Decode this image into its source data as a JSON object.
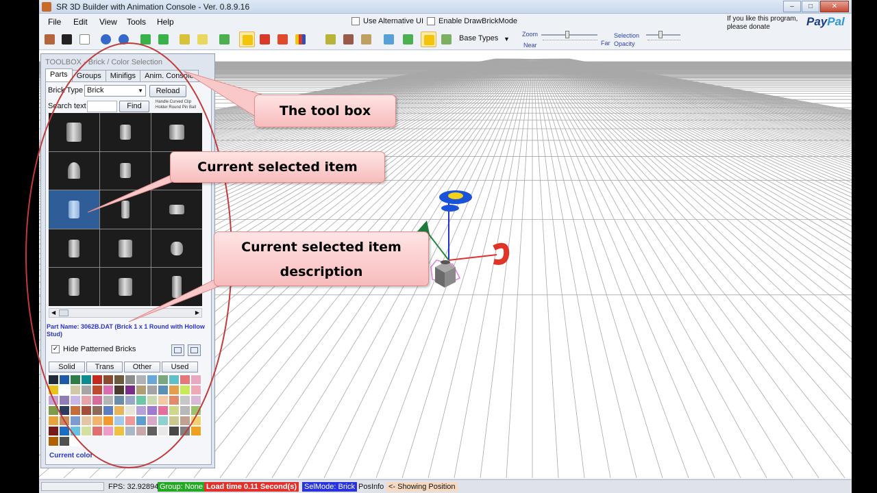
{
  "window": {
    "title": "SR 3D Builder with Animation Console - Ver. 0.8.9.16",
    "controls": [
      "–",
      "□",
      "✕"
    ]
  },
  "menu": [
    "File",
    "Edit",
    "View",
    "Tools",
    "Help"
  ],
  "options": {
    "alt_ui": "Use Alternative UI",
    "draw_brick": "Enable DrawBrickMode"
  },
  "donate": {
    "line1": "If you like this program,",
    "line2": "please donate",
    "paypal_pay": "Pay",
    "paypal_pal": "Pal"
  },
  "toolbar": {
    "icons": [
      "open-bricks-icon",
      "save-icon",
      "new-file-icon",
      "undo-icon",
      "redo-icon",
      "connect-icon",
      "disconnect-icon",
      "brick-yellow-icon",
      "brick-light-icon",
      "group-icon",
      "brick-select-icon",
      "brick-red-icon",
      "brick-pencil-icon",
      "color-bars-icon",
      "flex-icon",
      "brick-multi-icon",
      "brick-tilt-icon",
      "step-icon",
      "add-step-icon",
      "base-yellow-icon",
      "base-plate-icon"
    ],
    "base_types": "Base Types",
    "zoom": "Zoom",
    "near": "Near",
    "far": "Far",
    "selection": "Selection",
    "opacity": "Opacity"
  },
  "toolbox": {
    "title": "TOOLBOX - Brick / Color Selection",
    "tabs": [
      "Parts",
      "Groups",
      "Minifigs",
      "Anim. Console"
    ],
    "brick_type_label": "Brick Type",
    "brick_type_value": "Brick",
    "reload": "Reload",
    "search_label": "Search text",
    "find": "Find",
    "hint1": "Handle Curved Clip",
    "hint2": "Holder Round Pin Ball",
    "part_description": "Part Name: 3062B.DAT (Brick  1 x  1 Round with Hollow Stud)",
    "hide_patterned": "Hide Patterned Bricks",
    "color_tabs": [
      "Solid",
      "Trans",
      "Other",
      "Used"
    ],
    "current_color": "Current color"
  },
  "palette": [
    "#222b39",
    "#1e5aa8",
    "#2e7c46",
    "#0c8c91",
    "#c5281c",
    "#8d4a33",
    "#6b5a3e",
    "#8a8d8c",
    "#b0b2b6",
    "#6aa7d9",
    "#7ba77f",
    "#5ec1c7",
    "#e5767a",
    "#e7a8c0",
    "#e9c21c",
    "#ffffff",
    "#cfc9a6",
    "#a5a5a5",
    "#c04a2d",
    "#d96eaf",
    "#4d3a2e",
    "#7a2d86",
    "#b19d74",
    "#a3a3a3",
    "#5c8fb5",
    "#e2a04d",
    "#c9e85a",
    "#eea8b6",
    "#c6a0d8",
    "#8f7db8",
    "#c8b8e8",
    "#e4a4a8",
    "#d66c9c",
    "#b5b5b5",
    "#6b8ea8",
    "#9aa6c8",
    "#6bc7a8",
    "#c9d8b0",
    "#f3c9a3",
    "#e08b6b",
    "#c7c7c7",
    "#d9b8d8",
    "#7e9a4b",
    "#2d3b5c",
    "#c46d3a",
    "#a34d3b",
    "#8c6b5a",
    "#5e7fbf",
    "#e8b35a",
    "#e7e4d8",
    "#b8a1d8",
    "#9e7ad1",
    "#e26f9e",
    "#cfd88a",
    "#b8b8b8",
    "#9cc46f",
    "#e8a43c",
    "#c98b5a",
    "#7b9bd1",
    "#e4c4a4",
    "#f3b36b",
    "#f49a2c",
    "#a4c8ec",
    "#f09898",
    "#5a9fd0",
    "#d8a8c8",
    "#8fd0d0",
    "#c8c890",
    "#c0a090",
    "#f0d070",
    "#7a1b1b",
    "#1b6ec2",
    "#66c2e0",
    "#d4e0a0",
    "#e07070",
    "#f09cc8",
    "#f0c040",
    "#a8b8c8",
    "#c8a8a8",
    "#606060",
    "#e8e8e8",
    "#484848",
    "#808080",
    "#f0a020",
    "#b06000",
    "#505050",
    "#ffffff"
  ],
  "status": {
    "fps": "FPS:  32.92894",
    "group": "Group: None",
    "load": "Load time 0.11 Second(s)",
    "selmode": "SelMode: Brick",
    "posinfo": "PosInfo",
    "showing": "<- Showing Position"
  },
  "callouts": {
    "toolbox": "The tool box",
    "selected": "Current selected item",
    "desc_line1": "Current selected item",
    "desc_line2": "description"
  },
  "colors": {
    "status_green": "#23a823",
    "status_red": "#e0322b",
    "status_blue": "#2733e0",
    "status_peach": "#f6d9c0",
    "callout_stroke": "#c23a3a"
  }
}
